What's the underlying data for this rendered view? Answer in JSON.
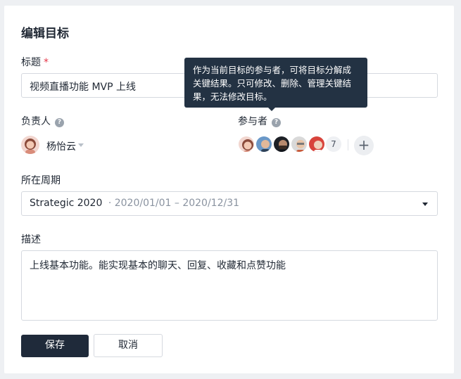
{
  "dialog": {
    "title": "编辑目标",
    "name_label": "标题",
    "required_mark": "*",
    "name_value": "视频直播功能 MVP 上线",
    "owner_label": "负责人",
    "owner_name": "杨怡云",
    "participants_label": "参与者",
    "participants_count": "7",
    "tooltip_text": "作为当前目标的参与者，可将目标分解成关键结果。只可修改、删除、管理关键结果，无法修改目标。",
    "period_label": "所在周期",
    "period_name": "Strategic 2020",
    "period_range": "· 2020/01/01 – 2020/12/31",
    "description_label": "描述",
    "description_value": "上线基本功能。能实现基本的聊天、回复、收藏和点赞功能",
    "save_label": "保存",
    "cancel_label": "取消"
  },
  "icons": {
    "help": "question-circle-icon",
    "caret": "caret-down-icon",
    "add": "plus-icon"
  },
  "colors": {
    "primary": "#1f2a3a",
    "tooltip_bg": "#233243",
    "required": "#e5384a"
  }
}
